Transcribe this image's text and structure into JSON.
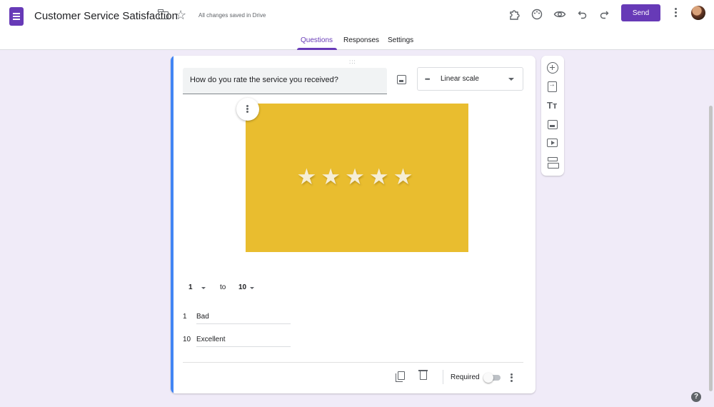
{
  "header": {
    "title": "Customer Service Satisfaction",
    "save_status": "All changes saved in Drive",
    "send_label": "Send",
    "icons": [
      "forms-app-icon",
      "folder-icon",
      "star-icon",
      "addon-puzzle-icon",
      "palette-icon",
      "preview-eye-icon",
      "undo-icon",
      "redo-icon",
      "more-vert-icon",
      "avatar"
    ]
  },
  "tabs": [
    {
      "label": "Questions",
      "active": true
    },
    {
      "label": "Responses",
      "active": false
    },
    {
      "label": "Settings",
      "active": false
    }
  ],
  "question": {
    "title": "How do you rate the service you received?",
    "type": "Linear scale",
    "image_stars": "★★★★★",
    "scale_from": "1",
    "scale_to_word": "to",
    "scale_to": "10",
    "low_label_num": "1",
    "low_label": "Bad",
    "high_label_num": "10",
    "high_label": "Excellent",
    "required_label": "Required",
    "required": false,
    "drag_handle": ":::"
  },
  "side_toolbar": {
    "text_glyph": "Tт",
    "tools": [
      "add-question",
      "import-questions",
      "add-title",
      "add-image",
      "add-video",
      "add-section"
    ]
  },
  "colors": {
    "accent": "#673ab7",
    "card_accent": "#4285f4",
    "background": "#f0ebf8",
    "image_yellow": "#e9bd2f"
  },
  "help_glyph": "?"
}
